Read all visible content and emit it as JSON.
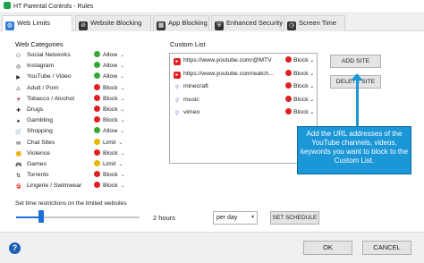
{
  "window": {
    "title": "HT Parental Controls - Rules"
  },
  "tabs": [
    {
      "label": "Web Limits",
      "icon": "globe-icon",
      "active": true
    },
    {
      "label": "Website Blocking",
      "icon": "block-icon",
      "active": false
    },
    {
      "label": "App Blocking",
      "icon": "app-icon",
      "active": false
    },
    {
      "label": "Enhanced Security",
      "icon": "shield-icon",
      "active": false
    },
    {
      "label": "Screen Time",
      "icon": "clock-icon",
      "active": false
    }
  ],
  "web_categories": {
    "heading": "Web Categories",
    "items": [
      {
        "label": "Social Networks",
        "status": "Allow",
        "color": "#36a836"
      },
      {
        "label": "Instagram",
        "status": "Allow",
        "color": "#36a836"
      },
      {
        "label": "YouTube / Video",
        "status": "Allow",
        "color": "#36a836"
      },
      {
        "label": "Adult / Porn",
        "status": "Block",
        "color": "#e02020"
      },
      {
        "label": "Tobacco / Alcohol",
        "status": "Block",
        "color": "#e02020"
      },
      {
        "label": "Drugs",
        "status": "Block",
        "color": "#e02020"
      },
      {
        "label": "Gambling",
        "status": "Block",
        "color": "#e02020"
      },
      {
        "label": "Shopping",
        "status": "Allow",
        "color": "#36a836"
      },
      {
        "label": "Chat Sites",
        "status": "Limit",
        "color": "#e6b800"
      },
      {
        "label": "Violence",
        "status": "Block",
        "color": "#e02020"
      },
      {
        "label": "Games",
        "status": "Limit",
        "color": "#e6b800"
      },
      {
        "label": "Torrents",
        "status": "Block",
        "color": "#e02020"
      },
      {
        "label": "Lingerie / Swimwear",
        "status": "Block",
        "color": "#e02020"
      }
    ]
  },
  "custom_list": {
    "heading": "Custom List",
    "items": [
      {
        "text": "https://www.youtube.com/@MTV",
        "status": "Block",
        "icon": "youtube-icon"
      },
      {
        "text": "https://www.youtube.com/watch...",
        "status": "Block",
        "icon": "youtube-icon"
      },
      {
        "text": "minecraft",
        "status": "Block",
        "icon": "keyword-icon"
      },
      {
        "text": "music",
        "status": "Block",
        "icon": "keyword-icon"
      },
      {
        "text": "vimeo",
        "status": "Block",
        "icon": "keyword-icon"
      }
    ],
    "add_site": "ADD SITE",
    "delete_site": "DELETE SITE"
  },
  "tooltip": {
    "text": "Add the URL addresses of the YouTube channels, videos, keywords you want to block to the Custom List."
  },
  "time_restrictions": {
    "label": "Set time restrictions on the limited websites",
    "value": "2 hours",
    "slider_fraction": 0.2,
    "period": "per day",
    "schedule_button": "SET SCHEDULE"
  },
  "footer": {
    "ok": "OK",
    "cancel": "CANCEL",
    "help": "?"
  },
  "colors": {
    "accent": "#1b96d6",
    "allow": "#36a836",
    "block": "#e02020",
    "limit": "#e6b800"
  }
}
